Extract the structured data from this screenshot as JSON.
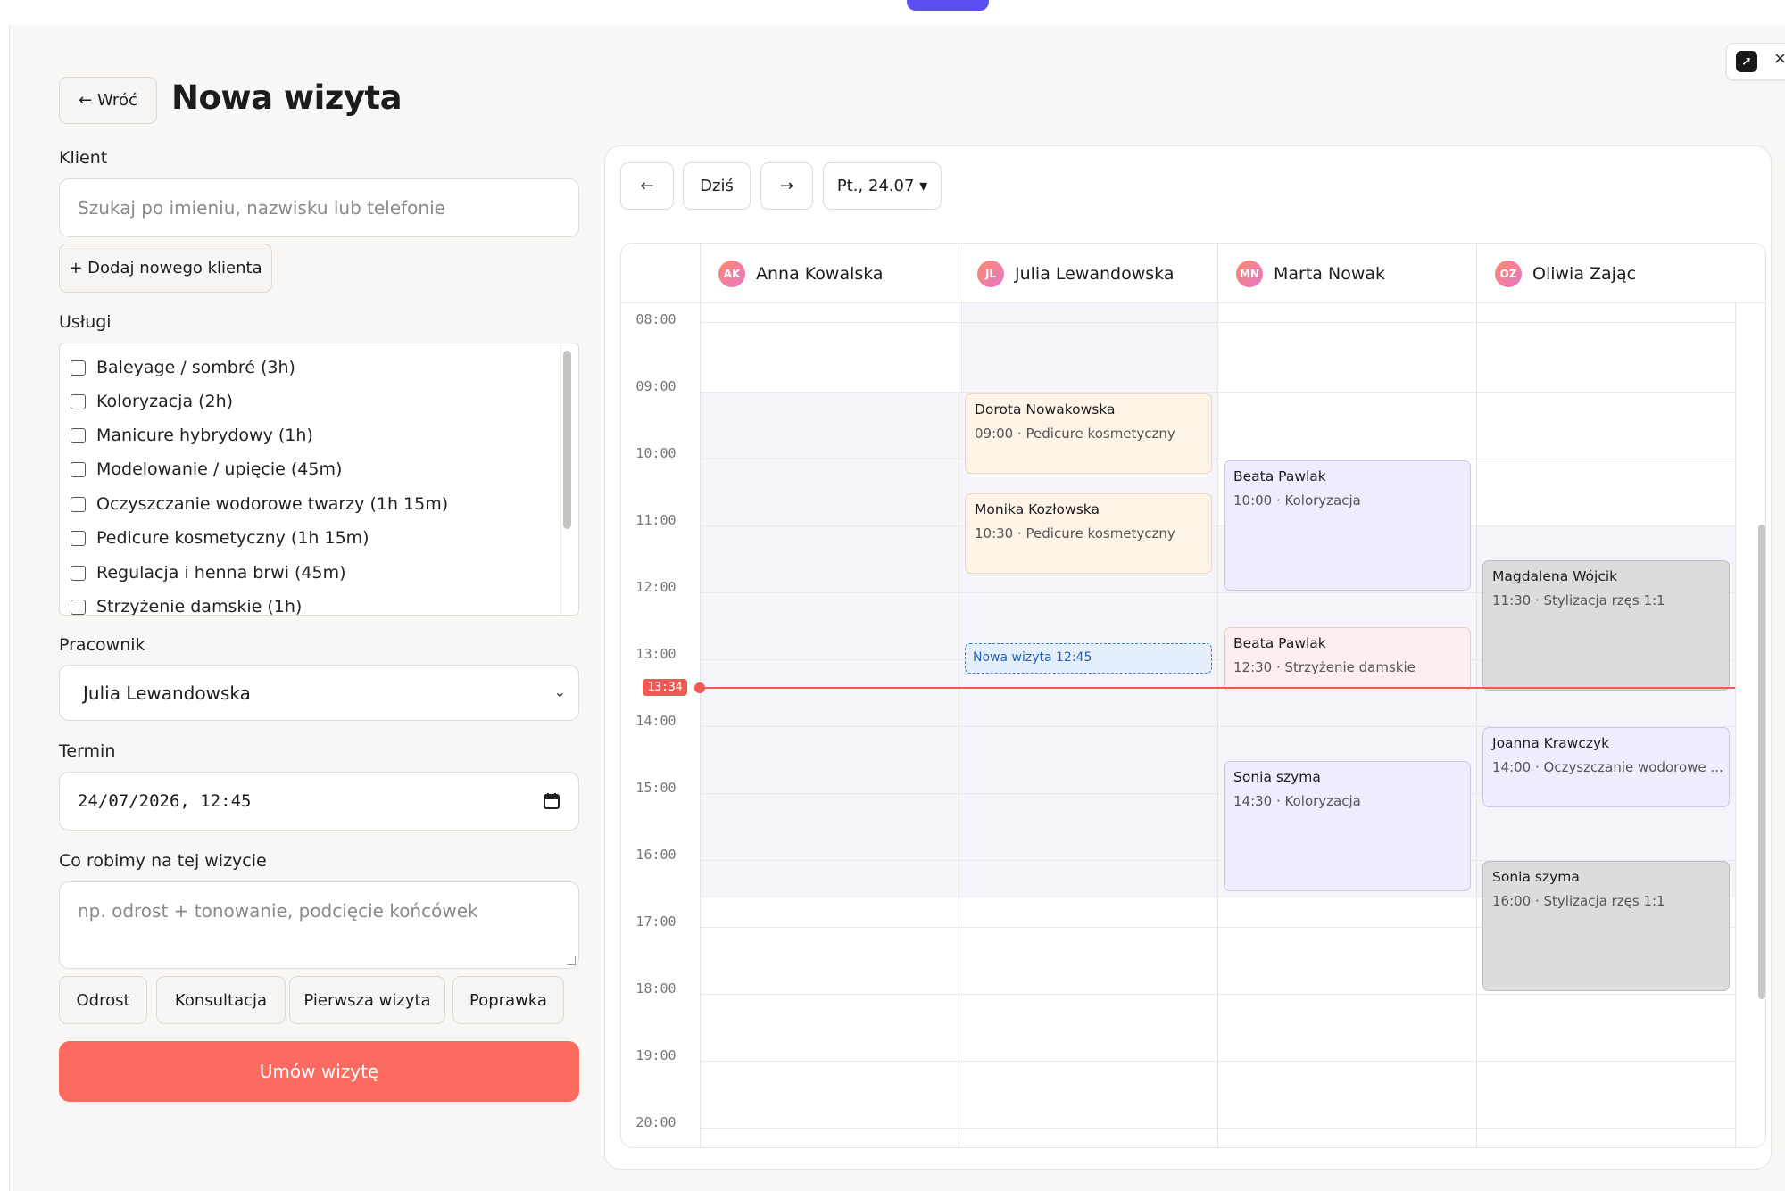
{
  "page": {
    "back_label": "← Wróć",
    "title": "Nowa wizyta"
  },
  "client": {
    "label": "Klient",
    "search_placeholder": "Szukaj po imieniu, nazwisku lub telefonie",
    "add_label": "+ Dodaj nowego klienta"
  },
  "services": {
    "label": "Usługi",
    "items": [
      "Baleyage / sombré (3h)",
      "Koloryzacja (2h)",
      "Manicure hybrydowy (1h)",
      "Modelowanie / upięcie (45m)",
      "Oczyszczanie wodorowe twarzy (1h 15m)",
      "Pedicure kosmetyczny (1h 15m)",
      "Regulacja i henna brwi (45m)",
      "Strzyżenie damskie (1h)"
    ]
  },
  "worker": {
    "label": "Pracownik",
    "selected": "Julia Lewandowska"
  },
  "term": {
    "label": "Termin",
    "value": "24/07/2026, 12:45"
  },
  "notes": {
    "label": "Co robimy na tej wizycie",
    "placeholder": "np. odrost + tonowanie, podcięcie końcówek",
    "chips": [
      "Odrost",
      "Konsultacja",
      "Pierwsza wizyta",
      "Poprawka"
    ]
  },
  "submit_label": "Umów wizytę",
  "calendar": {
    "prev_icon": "←",
    "today_label": "Dziś",
    "next_icon": "→",
    "date_label": "Pt., 24.07 ▾",
    "now_label": "13:34",
    "hours": [
      "08:00",
      "09:00",
      "10:00",
      "11:00",
      "12:00",
      "13:00",
      "14:00",
      "15:00",
      "16:00",
      "17:00",
      "18:00",
      "19:00",
      "20:00"
    ],
    "staff": [
      {
        "initials": "AK",
        "name": "Anna Kowalska"
      },
      {
        "initials": "JL",
        "name": "Julia Lewandowska"
      },
      {
        "initials": "MN",
        "name": "Marta Nowak"
      },
      {
        "initials": "OZ",
        "name": "Oliwia Zając"
      }
    ],
    "appointments": [
      {
        "client": "Dorota Nowakowska",
        "detail": "09:00 · Pedicure kosmetyczny"
      },
      {
        "client": "Monika Kozłowska",
        "detail": "10:30 · Pedicure kosmetyczny"
      },
      {
        "client": "Beata Pawlak",
        "detail": "10:00 · Koloryzacja"
      },
      {
        "client": "Beata Pawlak",
        "detail": "12:30 · Strzyżenie damskie"
      },
      {
        "client": "Sonia szyma",
        "detail": "14:30 · Koloryzacja"
      },
      {
        "client": "Magdalena Wójcik",
        "detail": "11:30 · Stylizacja rzęs 1:1"
      },
      {
        "client": "Joanna Krawczyk",
        "detail": "14:00 · Oczyszczanie wodorowe ..."
      },
      {
        "client": "Sonia szyma",
        "detail": "16:00 · Stylizacja rzęs 1:1"
      }
    ],
    "new_slot_label": "Nowa wizyta 12:45"
  },
  "colors": {
    "accent": "#fd6b60",
    "now_line": "#ef5a52",
    "pedicure_bg": "#fdf4e7",
    "koloryzacja_bg": "#efecfd",
    "strzyzenie_bg": "#fdeeee",
    "stylizacja_bg": "#dcdcdc"
  }
}
